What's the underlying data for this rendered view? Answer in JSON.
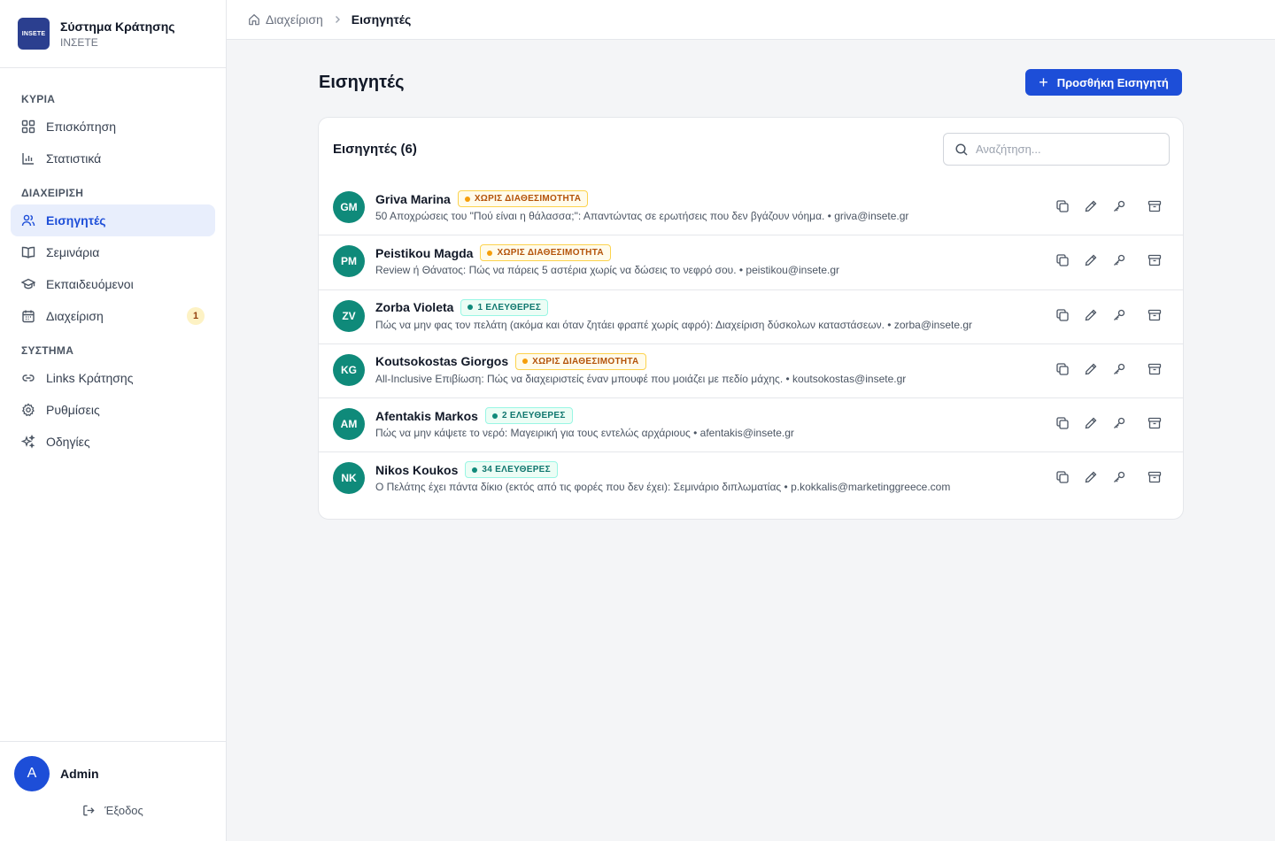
{
  "brand": {
    "logo_text": "INSETE",
    "title": "Σύστημα Κράτησης",
    "subtitle": "ΙΝΣΕΤΕ"
  },
  "sidebar": {
    "sections": [
      {
        "label": "ΚΥΡΙΑ",
        "items": [
          {
            "label": "Επισκόπηση",
            "icon": "grid-icon"
          },
          {
            "label": "Στατιστικά",
            "icon": "bar-chart-icon"
          }
        ]
      },
      {
        "label": "ΔΙΑΧΕΙΡΙΣΗ",
        "items": [
          {
            "label": "Εισηγητές",
            "icon": "users-icon",
            "active": true
          },
          {
            "label": "Σεμινάρια",
            "icon": "book-icon"
          },
          {
            "label": "Εκπαιδευόμενοι",
            "icon": "graduation-cap-icon"
          },
          {
            "label": "Διαχείριση",
            "icon": "calendar-icon",
            "badge": "1"
          }
        ]
      },
      {
        "label": "ΣΥΣΤΗΜΑ",
        "items": [
          {
            "label": "Links Κράτησης",
            "icon": "link-icon"
          },
          {
            "label": "Ρυθμίσεις",
            "icon": "gear-icon"
          },
          {
            "label": "Οδηγίες",
            "icon": "sparkles-icon"
          }
        ]
      }
    ]
  },
  "user": {
    "initial": "A",
    "name": "Admin",
    "logout_label": "Έξοδος"
  },
  "breadcrumb": {
    "home": "Διαχείριση",
    "current": "Εισηγητές"
  },
  "page": {
    "title": "Εισηγητές",
    "add_button": "Προσθήκη Εισηγητή"
  },
  "list": {
    "title": "Εισηγητές (6)",
    "search_placeholder": "Αναζήτηση...",
    "rows": [
      {
        "initials": "GM",
        "name": "Griva Marina",
        "badge": "ΧΩΡΙΣ ΔΙΑΘΕΣΙΜΟΤΗΤΑ",
        "badge_type": "warn",
        "desc": "50 Αποχρώσεις του \"Πού είναι η θάλασσα;\": Απαντώντας σε ερωτήσεις που δεν βγάζουν νόημα. • griva@insete.gr"
      },
      {
        "initials": "PM",
        "name": "Peistikou Magda",
        "badge": "ΧΩΡΙΣ ΔΙΑΘΕΣΙΜΟΤΗΤΑ",
        "badge_type": "warn",
        "desc": "Review ή Θάνατος: Πώς να πάρεις 5 αστέρια χωρίς να δώσεις το νεφρό σου. • peistikou@insete.gr"
      },
      {
        "initials": "ZV",
        "name": "Zorba Violeta",
        "badge": "1 ΕΛΕΥΘΕΡΕΣ",
        "badge_type": "ok",
        "desc": "Πώς να μην φας τον πελάτη (ακόμα και όταν ζητάει φραπέ χωρίς αφρό): Διαχείριση δύσκολων καταστάσεων. • zorba@insete.gr"
      },
      {
        "initials": "KG",
        "name": "Koutsokostas Giorgos",
        "badge": "ΧΩΡΙΣ ΔΙΑΘΕΣΙΜΟΤΗΤΑ",
        "badge_type": "warn",
        "desc": "All-Inclusive Επιβίωση: Πώς να διαχειριστείς έναν μπουφέ που μοιάζει με πεδίο μάχης. • koutsokostas@insete.gr"
      },
      {
        "initials": "AM",
        "name": "Afentakis Markos",
        "badge": "2 ΕΛΕΥΘΕΡΕΣ",
        "badge_type": "ok",
        "desc": "Πώς να μην κάψετε το νερό: Μαγειρική για τους εντελώς αρχάριους • afentakis@insete.gr"
      },
      {
        "initials": "NK",
        "name": "Nikos Koukos",
        "badge": "34 ΕΛΕΥΘΕΡΕΣ",
        "badge_type": "ok",
        "desc": "Ο Πελάτης έχει πάντα δίκιο (εκτός από τις φορές που δεν έχει): Σεμινάριο διπλωματίας • p.kokkalis@marketinggreece.com"
      }
    ]
  },
  "colors": {
    "accent": "#1d4ed8",
    "avatar": "#0f8a7a",
    "warn": "#b45309",
    "ok": "#0f766e"
  }
}
